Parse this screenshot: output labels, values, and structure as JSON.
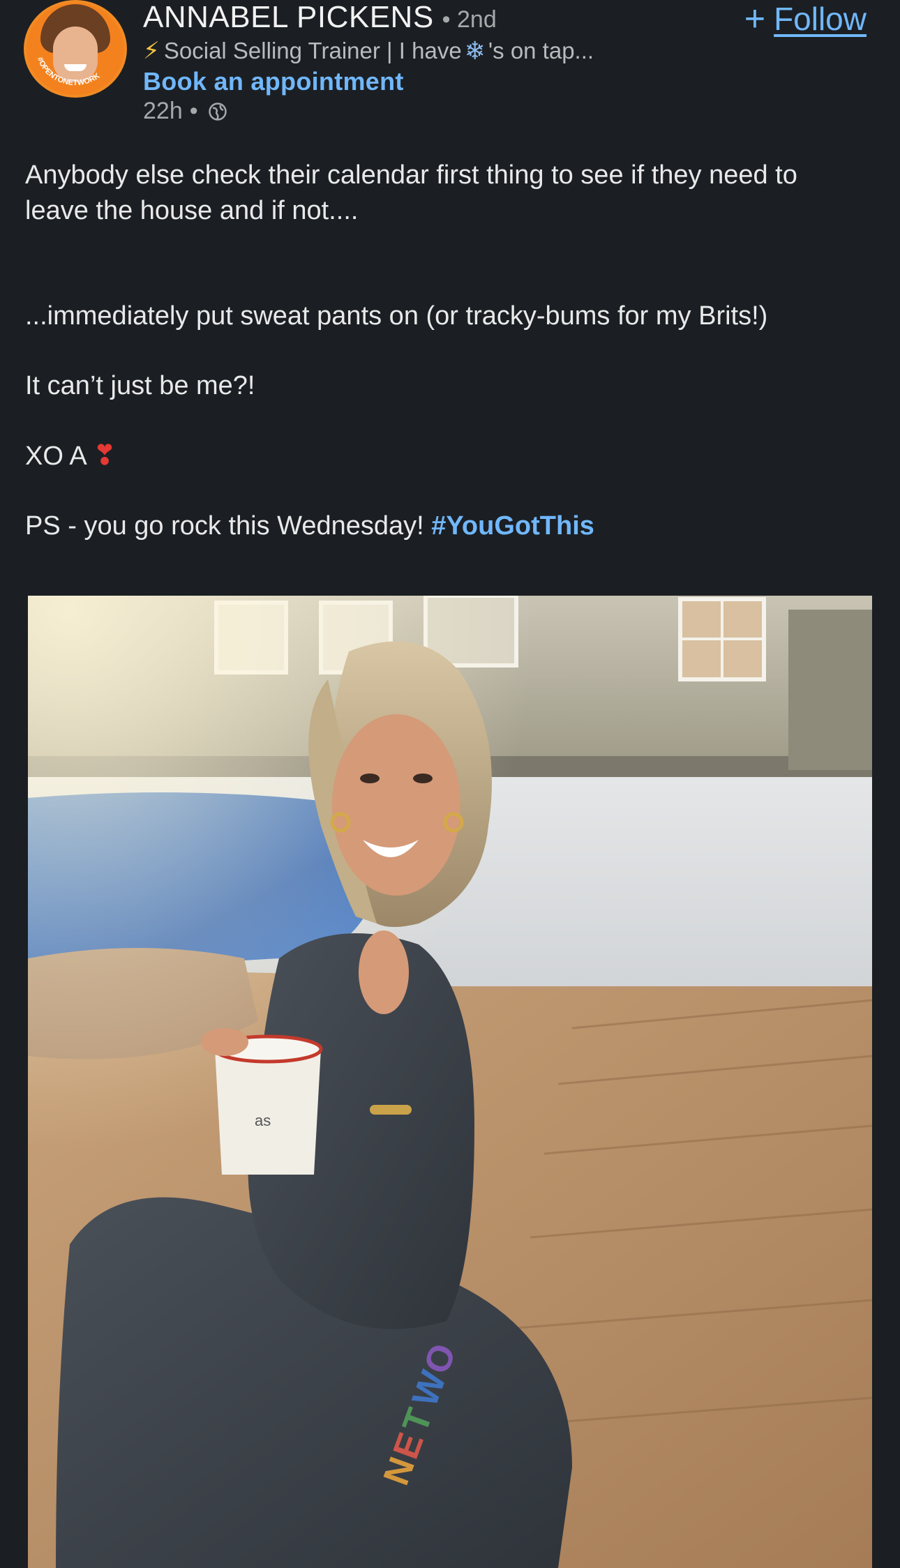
{
  "author": {
    "name": "ANNABEL PICKENS",
    "degree": "• 2nd",
    "headline_prefix": "Social Selling Trainer | I have",
    "headline_suffix": "'s on tap...",
    "cta": "Book an appointment",
    "time": "22h",
    "time_separator": "•",
    "avatar_ring_text": "#OPENTONETWORK"
  },
  "follow": {
    "plus": "+",
    "label": "Follow"
  },
  "post": {
    "line1": "Anybody else check their calendar first thing to see if they need to leave the house and if not....",
    "line2": "...immediately put sweat pants on (or tracky-bums for my Brits!)",
    "line3": "It can’t just be me?!",
    "line4": "XO A",
    "line5_prefix": "PS - you go rock this Wednesday!",
    "hashtag": "#YouGotThis"
  },
  "photo": {
    "mug_text": "as"
  },
  "colors": {
    "background": "#1b1f23",
    "link": "#71b7fb",
    "text": "#e9e9ea",
    "muted": "#a7a9ab"
  },
  "icons": {
    "headline_icon_1": "lightning-bolt-icon",
    "headline_icon_2": "snowflake-icon",
    "visibility": "globe-icon",
    "signature": "red-heart-exclamation-icon",
    "follow": "plus-icon"
  }
}
